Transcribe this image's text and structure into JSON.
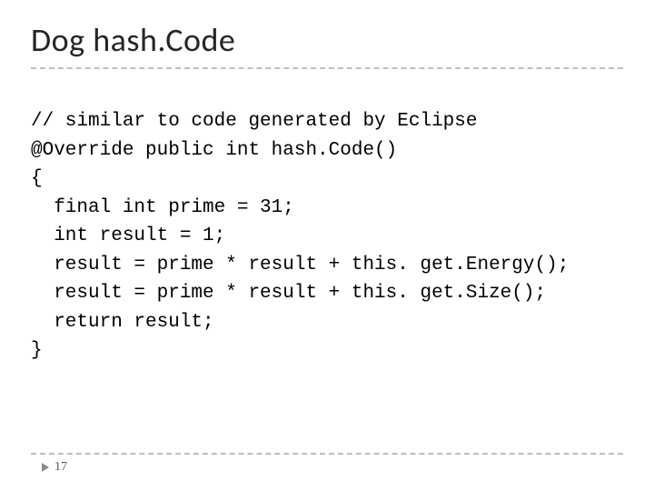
{
  "slide": {
    "title": "Dog hash.Code",
    "page_number": "17",
    "code": {
      "l1": "// similar to code generated by Eclipse",
      "l2": "@Override public int hash.Code()",
      "l3": "{",
      "l4": "  final int prime = 31;",
      "l5": "  int result = 1;",
      "l6": "  result = prime * result + this. get.Energy();",
      "l7": "  result = prime * result + this. get.Size();",
      "l8": "  return result;",
      "l9": "}"
    }
  }
}
